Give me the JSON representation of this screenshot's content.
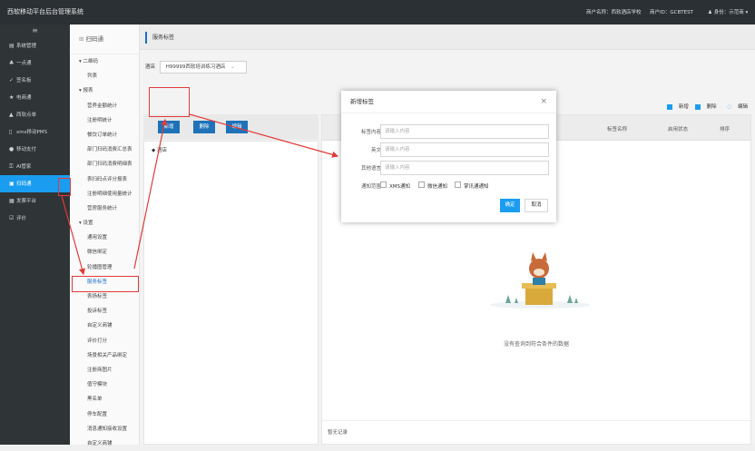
{
  "header": {
    "app_title": "西软移动平台后台管理系统",
    "user_name": "商户名称：西软酒店学校",
    "merchant_id": "商户ID：GCBTEST",
    "user_menu": "身份：示范商"
  },
  "sidebar": {
    "toggle_icon": "menu-icon",
    "items": [
      {
        "label": "系统管理",
        "icon": "list-icon"
      },
      {
        "label": "一点通",
        "icon": "thumb-icon"
      },
      {
        "label": "签名板",
        "icon": "pen-icon"
      },
      {
        "label": "电商通",
        "icon": "star-icon"
      },
      {
        "label": "西软点单",
        "icon": "triangle-icon"
      },
      {
        "label": "xms移动PMS",
        "icon": "phone-icon"
      },
      {
        "label": "移动支付",
        "icon": "dot-icon"
      },
      {
        "label": "AI管家",
        "icon": "lock-icon"
      },
      {
        "label": "扫码通",
        "icon": "qr-icon",
        "active": true
      },
      {
        "label": "发票平台",
        "icon": "doc-icon"
      },
      {
        "label": "评价",
        "icon": "edit-icon"
      }
    ]
  },
  "submenu": {
    "title": "扫码通",
    "rows": [
      {
        "label": "二维码",
        "type": "group"
      },
      {
        "label": "列表",
        "type": "leaf"
      },
      {
        "label": "报表",
        "type": "group"
      },
      {
        "label": "营养金额统计",
        "type": "leaf"
      },
      {
        "label": "注册明统计",
        "type": "leaf"
      },
      {
        "label": "餐饮订单统计",
        "type": "leaf"
      },
      {
        "label": "部门扫码消费汇总表",
        "type": "leaf"
      },
      {
        "label": "部门扫码消费明细表",
        "type": "leaf"
      },
      {
        "label": "表扫码点评分报表",
        "type": "leaf"
      },
      {
        "label": "注册明细使用量统计",
        "type": "leaf"
      },
      {
        "label": "营房服务统计",
        "type": "leaf"
      },
      {
        "label": "设置",
        "type": "group"
      },
      {
        "label": "通用设置",
        "type": "leaf"
      },
      {
        "label": "微信绑定",
        "type": "leaf"
      },
      {
        "label": "轮播图管理",
        "type": "leaf"
      },
      {
        "label": "服务标签",
        "type": "leaf",
        "selected": true
      },
      {
        "label": "表扬标签",
        "type": "leaf"
      },
      {
        "label": "投诉标签",
        "type": "leaf"
      },
      {
        "label": "自定义商铺",
        "type": "leaf"
      },
      {
        "label": "评价打分",
        "type": "leaf"
      },
      {
        "label": "场景相关产品绑定",
        "type": "leaf"
      },
      {
        "label": "注册商图片",
        "type": "leaf"
      },
      {
        "label": "值守模块",
        "type": "leaf"
      },
      {
        "label": "黑名单",
        "type": "leaf"
      },
      {
        "label": "停车配置",
        "type": "leaf"
      },
      {
        "label": "消息通知接收设置",
        "type": "leaf"
      },
      {
        "label": "自定义商铺",
        "type": "leaf"
      }
    ]
  },
  "main": {
    "tab": "服务标签",
    "filter_label": "酒店",
    "filter_value": "H99999西软培训练习酒店",
    "tools": {
      "add": "新增",
      "delete": "删除",
      "edit": "编辑"
    },
    "buttons": {
      "add": "新增",
      "delete": "删除",
      "edit": "编辑"
    },
    "tree_root": "酒店",
    "columns": [
      "标签名称",
      "启用状态",
      "排序"
    ],
    "empty_text": "没有查询到符合条件的数据",
    "footer_text": "暂无记录"
  },
  "modal": {
    "title": "新增标签",
    "fields": [
      {
        "label": "标签内容",
        "placeholder": "请输入内容"
      },
      {
        "label": "英文",
        "placeholder": "请输入内容"
      },
      {
        "label": "其他语言",
        "placeholder": "请输入内容"
      }
    ],
    "scope_label": "通知范围",
    "scope_options": [
      "XMS通知",
      "微信通知",
      "掌讯通通知"
    ],
    "confirm": "确定",
    "cancel": "取消"
  },
  "colors": {
    "topbar": "#2b3034",
    "sidebar": "#2f3437",
    "accent": "#1a9df0",
    "button": "#1e72b8",
    "annotation": "#e23b3b"
  }
}
